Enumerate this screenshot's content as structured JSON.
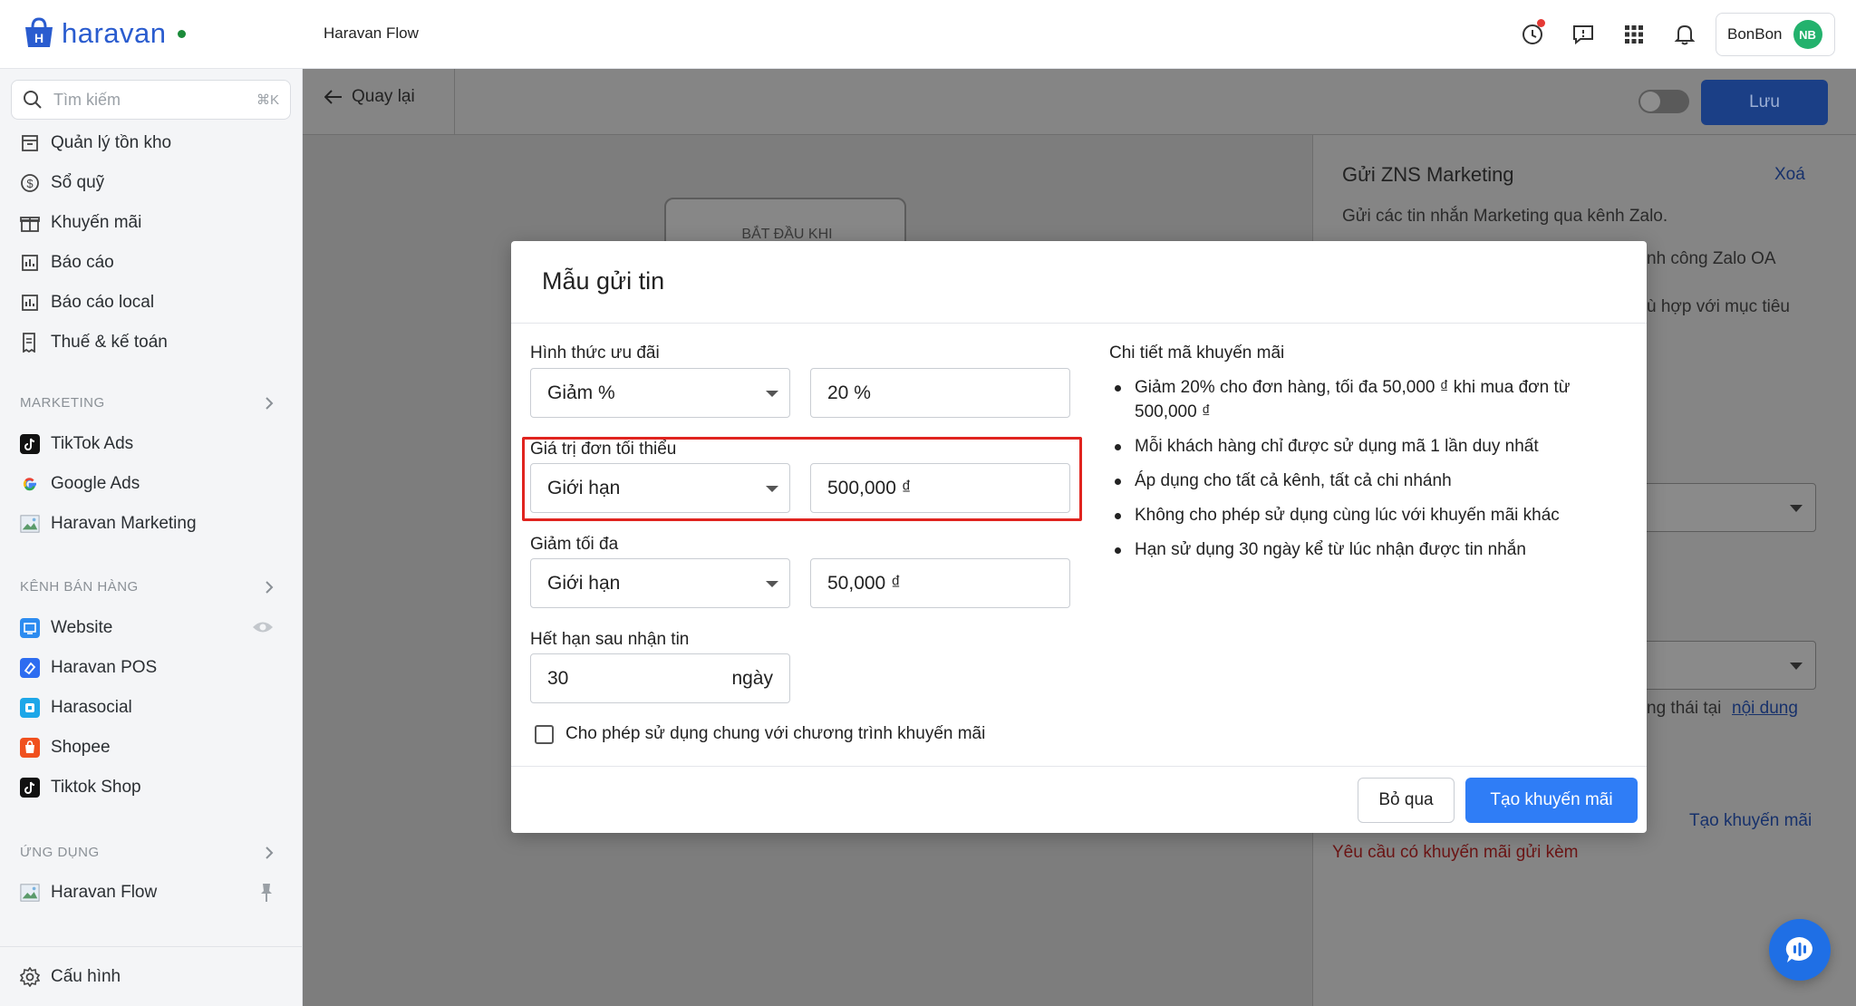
{
  "topbar": {
    "logo_text": "haravan",
    "app_title": "Haravan Flow",
    "user_name": "BonBon",
    "user_initials": "NB",
    "icons": [
      "update-icon",
      "feedback-icon",
      "apps-grid-icon",
      "bell-icon"
    ]
  },
  "sidebar": {
    "search_placeholder": "Tìm kiếm",
    "search_shortcut": "⌘K",
    "items_top": [
      {
        "label": "Quản lý tồn kho",
        "icon": "inventory-icon"
      },
      {
        "label": "Sổ quỹ",
        "icon": "dollar-icon"
      },
      {
        "label": "Khuyến mãi",
        "icon": "gift-icon"
      },
      {
        "label": "Báo cáo",
        "icon": "chart-icon"
      },
      {
        "label": "Báo cáo local",
        "icon": "chart-icon"
      },
      {
        "label": "Thuế & kế toán",
        "icon": "receipt-icon"
      }
    ],
    "section_marketing": "MARKETING",
    "marketing_items": [
      {
        "label": "TikTok Ads",
        "icon": "tiktok-icon"
      },
      {
        "label": "Google Ads",
        "icon": "google-icon"
      },
      {
        "label": "Haravan Marketing",
        "icon": "image-icon"
      }
    ],
    "section_channels": "KÊNH BÁN HÀNG",
    "channel_items": [
      {
        "label": "Website",
        "icon": "website-icon"
      },
      {
        "label": "Haravan POS",
        "icon": "pos-icon"
      },
      {
        "label": "Harasocial",
        "icon": "harasocial-icon"
      },
      {
        "label": "Shopee",
        "icon": "shopee-icon"
      },
      {
        "label": "Tiktok Shop",
        "icon": "tiktok-icon"
      }
    ],
    "section_apps": "ỨNG DỤNG",
    "app_items": [
      {
        "label": "Haravan Flow",
        "icon": "image-icon"
      }
    ],
    "settings_label": "Cấu hình"
  },
  "page": {
    "back_label": "Quay lại",
    "save_label": "Lưu",
    "start_node_label": "BẮT ĐẦU KHI"
  },
  "right_panel": {
    "title": "Gửi ZNS Marketing",
    "delete_label": "Xoá",
    "desc": "Gửi các tin nhắn Marketing qua kênh Zalo.",
    "partial_1": "nh công Zalo OA",
    "partial_2": "ù hợp với mục tiêu",
    "partial_3": "ng thái tại",
    "link_content": "nội dung",
    "link_create": "Tạo khuyến mãi",
    "error": "Yêu cầu có khuyến mãi gửi kèm"
  },
  "modal": {
    "title": "Mẫu gửi tin",
    "discount_type_label": "Hình thức ưu đãi",
    "discount_type_value": "Giảm %",
    "discount_value": "20 %",
    "min_order_label": "Giá trị đơn tối thiểu",
    "min_order_type": "Giới hạn",
    "min_order_value": "500,000 ₫",
    "max_discount_label": "Giảm tối đa",
    "max_discount_type": "Giới hạn",
    "max_discount_value": "50,000 ₫",
    "expire_label": "Hết hạn sau nhận tin",
    "expire_value": "30",
    "expire_unit": "ngày",
    "combine_checked": false,
    "combine_label": "Cho phép sử dụng chung với chương trình khuyến mãi",
    "details_title": "Chi tiết mã khuyến mãi",
    "details": [
      "Giảm 20% cho đơn hàng, tối đa 50,000 ₫ khi mua đơn từ 500,000 ₫",
      "Mỗi khách hàng chỉ được sử dụng mã 1 lần duy nhất",
      "Áp dụng cho tất cả kênh, tất cả chi nhánh",
      "Không cho phép sử dụng cùng lúc với khuyến mãi khác",
      "Hạn sử dụng 30 ngày kể từ lúc nhận được tin nhắn"
    ],
    "cancel_label": "Bỏ qua",
    "create_label": "Tạo khuyến mãi"
  },
  "colors": {
    "brand": "#2a5ccf",
    "primary_button": "#2f7df6",
    "highlight": "#e0241f",
    "avatar": "#23b26d"
  }
}
